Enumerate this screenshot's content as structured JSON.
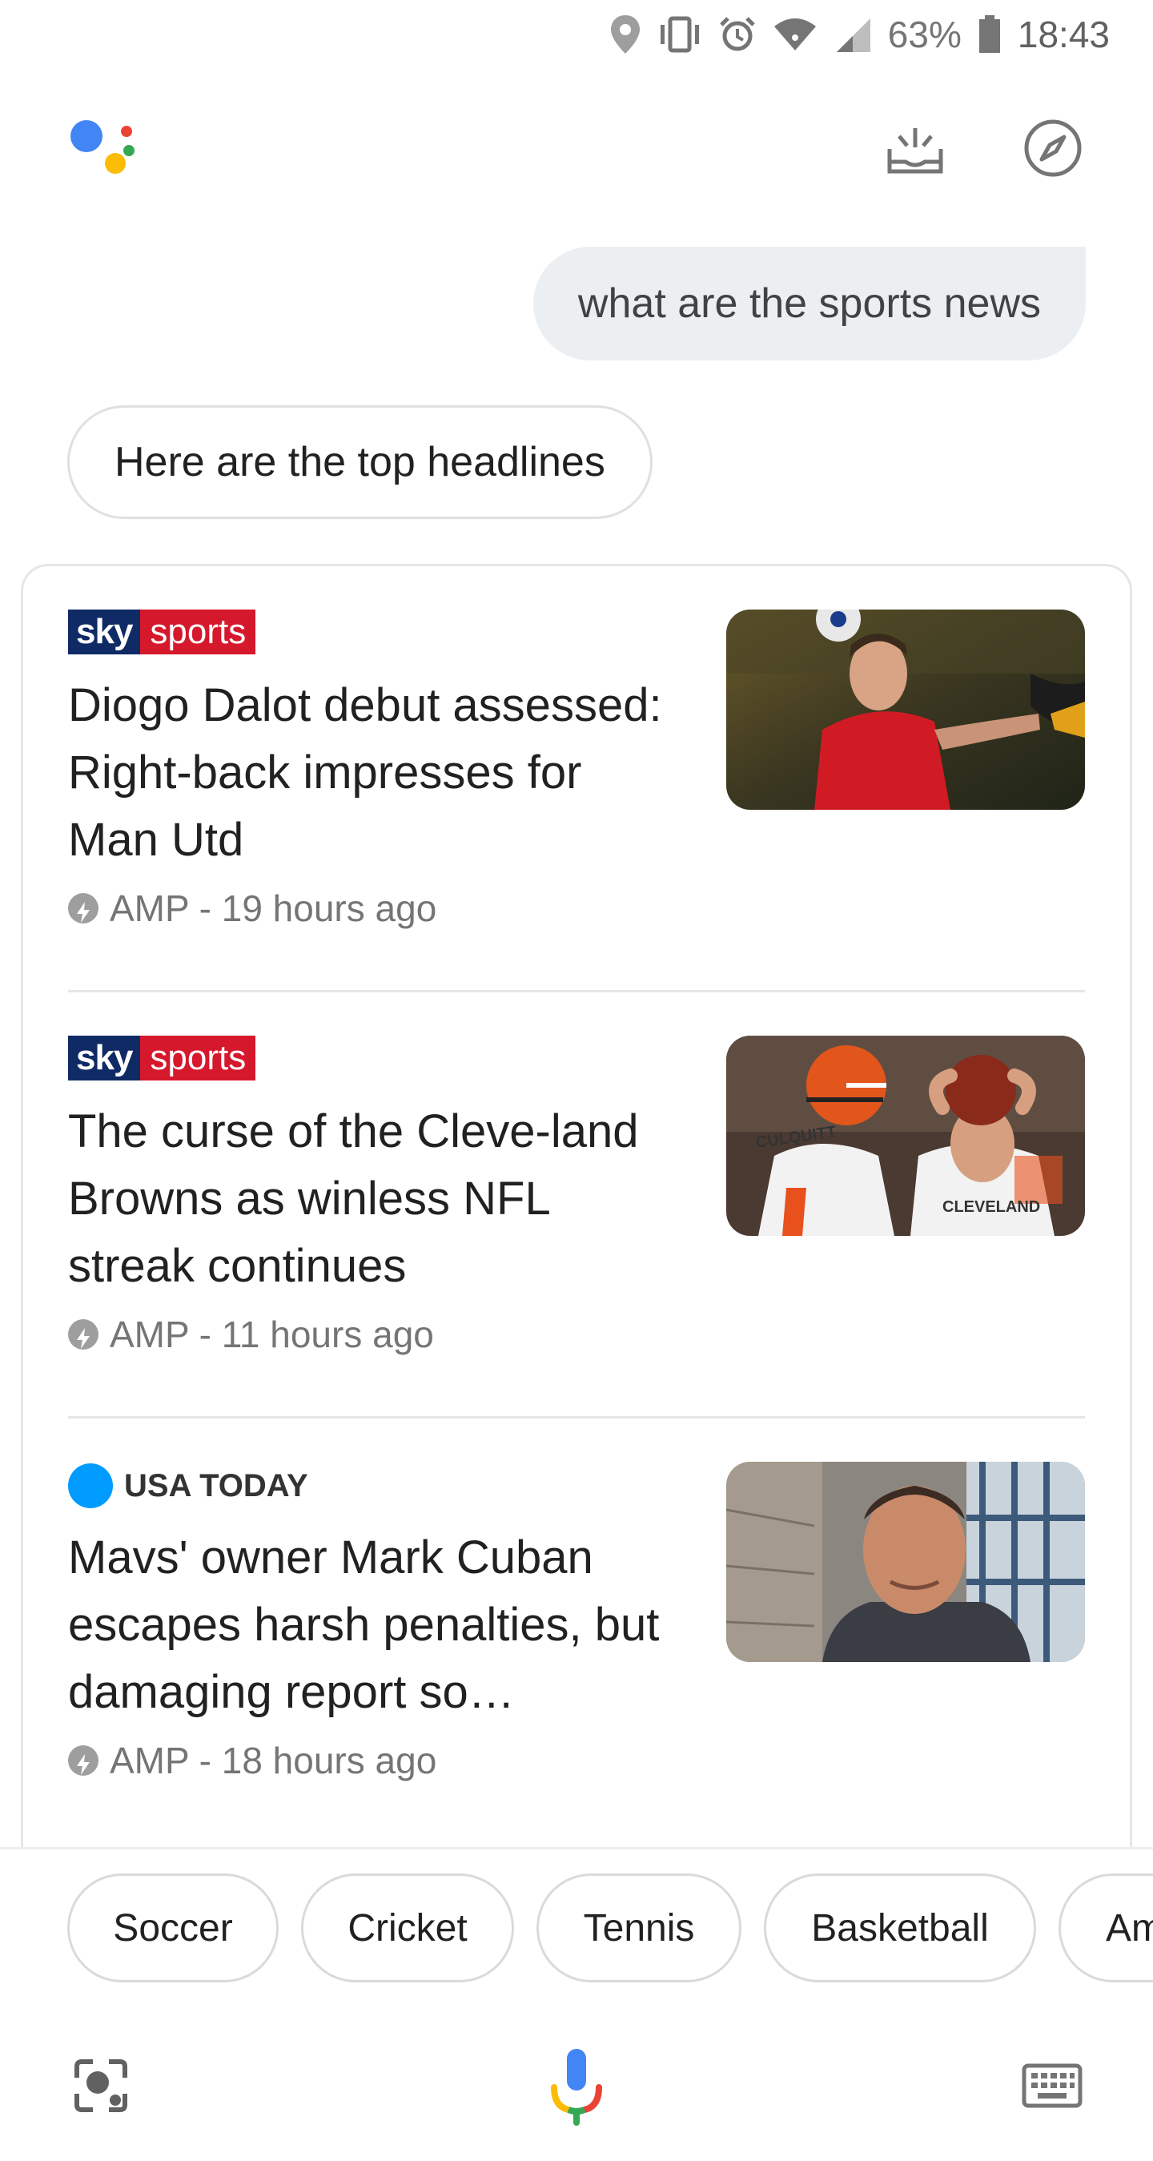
{
  "status_bar": {
    "battery": "63%",
    "time": "18:43"
  },
  "conversation": {
    "user_query": "what are the sports news",
    "assistant_reply": "Here are the top headlines"
  },
  "news": [
    {
      "source": "sky sports",
      "source_parts": [
        "sky",
        "sports"
      ],
      "headline": "Diogo Dalot debut assessed: Right-back impresses for Man Utd",
      "meta": "AMP - 19 hours ago"
    },
    {
      "source": "sky sports",
      "source_parts": [
        "sky",
        "sports"
      ],
      "headline": "The curse of the Cleve-land Browns as winless NFL streak continues",
      "meta": "AMP - 11 hours ago",
      "image_text": [
        "CULQUITT",
        "CLEVELAND"
      ]
    },
    {
      "source": "USA TODAY",
      "headline": "Mavs' owner Mark Cuban escapes harsh penalties, but damaging report so…",
      "meta": "AMP - 18 hours ago"
    }
  ],
  "chips": [
    "Soccer",
    "Cricket",
    "Tennis",
    "Basketball",
    "Am"
  ],
  "colors": {
    "google_blue": "#4285f4",
    "google_red": "#ea4335",
    "google_yellow": "#fbbc05",
    "google_green": "#34a853",
    "sky_blue": "#102a66",
    "sky_red": "#d6182c",
    "usa_today_blue": "#009bff"
  },
  "icons": {
    "status": [
      "location-icon",
      "vibrate-icon",
      "alarm-icon",
      "wifi-icon",
      "signal-icon",
      "battery-icon"
    ],
    "header": [
      "assistant-logo",
      "inbox-updates-icon",
      "explore-compass-icon"
    ],
    "bottom": [
      "lens-icon",
      "mic-icon",
      "keyboard-icon"
    ]
  }
}
